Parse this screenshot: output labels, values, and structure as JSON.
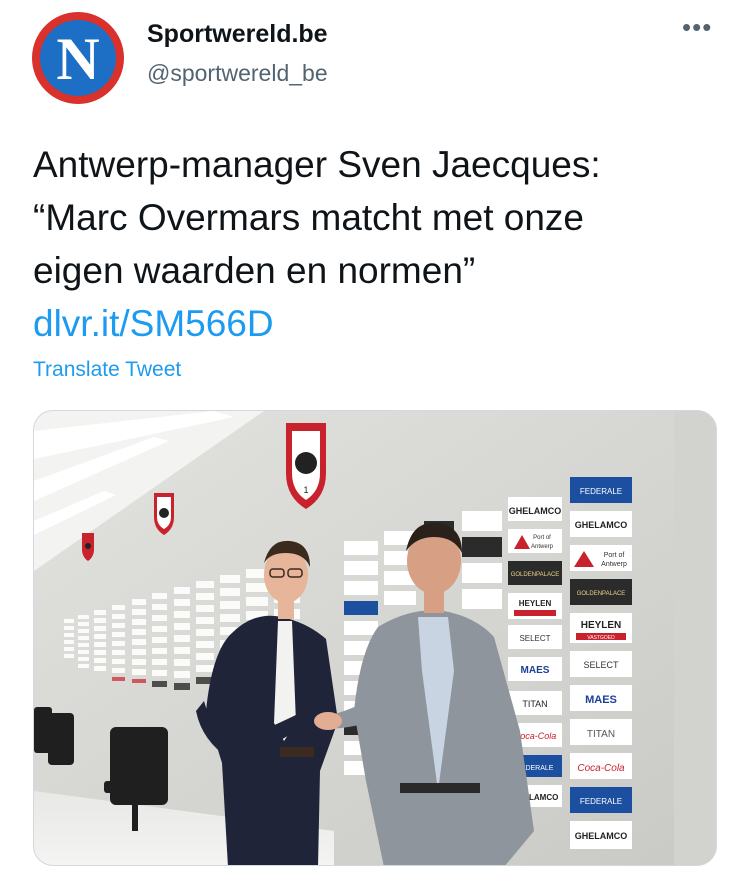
{
  "account": {
    "avatar_letter": "N",
    "display_name": "Sportwereld.be",
    "handle": "@sportwereld_be"
  },
  "header": {
    "more_label": "•••"
  },
  "tweet": {
    "line1": "Antwerp-manager Sven Jaecques:",
    "line2": "“Marc Overmars matcht met onze",
    "line3": "eigen waarden en normen”",
    "link": "dlvr.it/SM566D",
    "translate_label": "Translate Tweet"
  },
  "photo": {
    "club_badge_number": "1",
    "sponsors": {
      "federale": "FEDERALE",
      "ghelamco": "GHELAMCO",
      "port_of": "Port of",
      "antwerp": "Antwerp",
      "goldenpalace": "GOLDENPALACE",
      "heylen": "HEYLEN",
      "vastgoed": "VASTGOED",
      "select": "SELECT",
      "maes": "MAES",
      "titan": "TITAN",
      "coca_cola": "Coca-Cola"
    }
  },
  "colors": {
    "link": "#1d9bf0",
    "secondary_text": "#536471",
    "avatar_ring": "#d9312b",
    "avatar_fill": "#1c6fc4",
    "club_red": "#c8232c"
  }
}
